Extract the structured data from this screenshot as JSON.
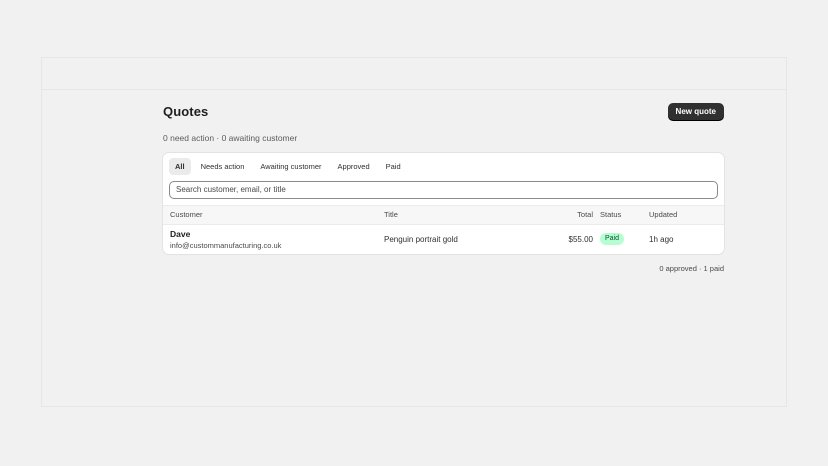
{
  "header": {
    "title": "Quotes",
    "new_quote_label": "New quote"
  },
  "summary": "0 need action · 0 awaiting customer",
  "tabs": [
    {
      "label": "All",
      "active": true
    },
    {
      "label": "Needs action",
      "active": false
    },
    {
      "label": "Awaiting customer",
      "active": false
    },
    {
      "label": "Approved",
      "active": false
    },
    {
      "label": "Paid",
      "active": false
    }
  ],
  "search": {
    "placeholder": "Search customer, email, or title",
    "value": ""
  },
  "table": {
    "columns": {
      "customer": "Customer",
      "title": "Title",
      "total": "Total",
      "status": "Status",
      "updated": "Updated"
    },
    "rows": [
      {
        "customer_name": "Dave",
        "customer_email": "info@custommanufacturing.co.uk",
        "title": "Penguin portrait gold",
        "total": "$55.00",
        "status": "Paid",
        "updated": "1h ago"
      }
    ]
  },
  "footer": "0 approved · 1 paid",
  "colors": {
    "primary_button": "#303030",
    "paid_badge_bg": "#b4fed2",
    "paid_badge_text": "#0c5132",
    "background": "#f1f1f1"
  }
}
